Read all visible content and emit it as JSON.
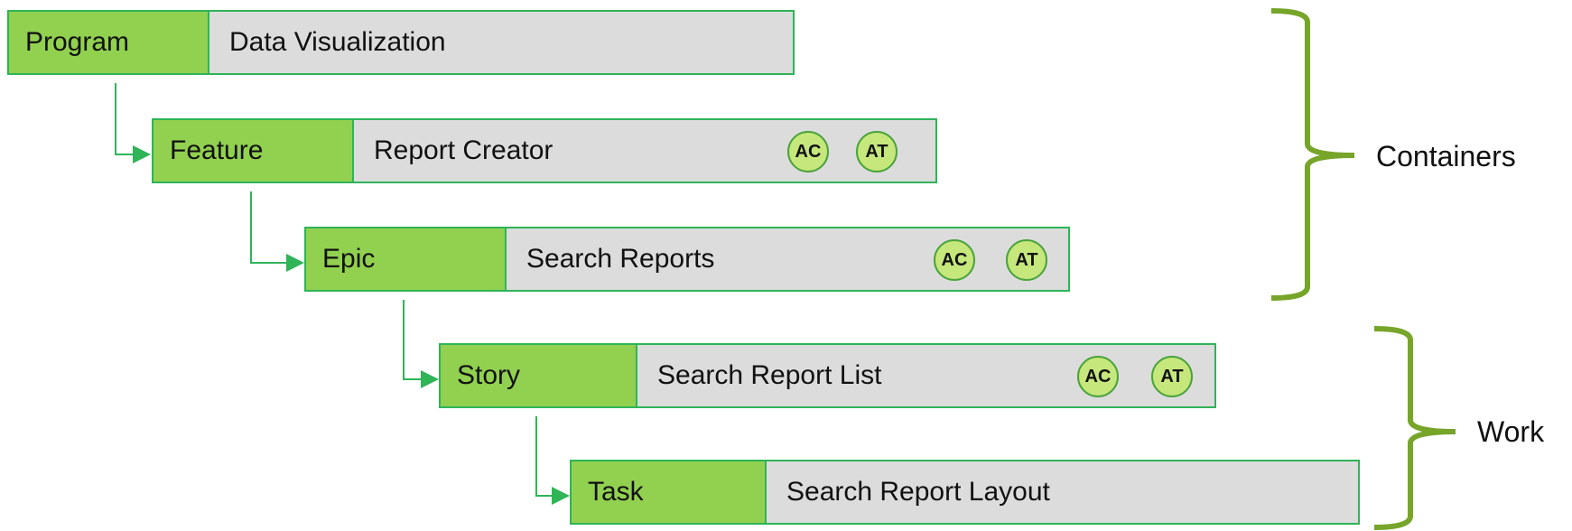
{
  "colors": {
    "label_fill": "#92d050",
    "value_fill": "#dcdcdc",
    "border": "#2fb457",
    "badge_fill": "#c6e77c",
    "bracket": "#77a52a"
  },
  "rows": [
    {
      "label": "Program",
      "value": "Data Visualization",
      "badges": []
    },
    {
      "label": "Feature",
      "value": "Report Creator",
      "badges": [
        "AC",
        "AT"
      ]
    },
    {
      "label": "Epic",
      "value": "Search Reports",
      "badges": [
        "AC",
        "AT"
      ]
    },
    {
      "label": "Story",
      "value": "Search Report List",
      "badges": [
        "AC",
        "AT"
      ]
    },
    {
      "label": "Task",
      "value": "Search Report Layout",
      "badges": []
    }
  ],
  "groups": {
    "containers": "Containers",
    "work": "Work"
  }
}
